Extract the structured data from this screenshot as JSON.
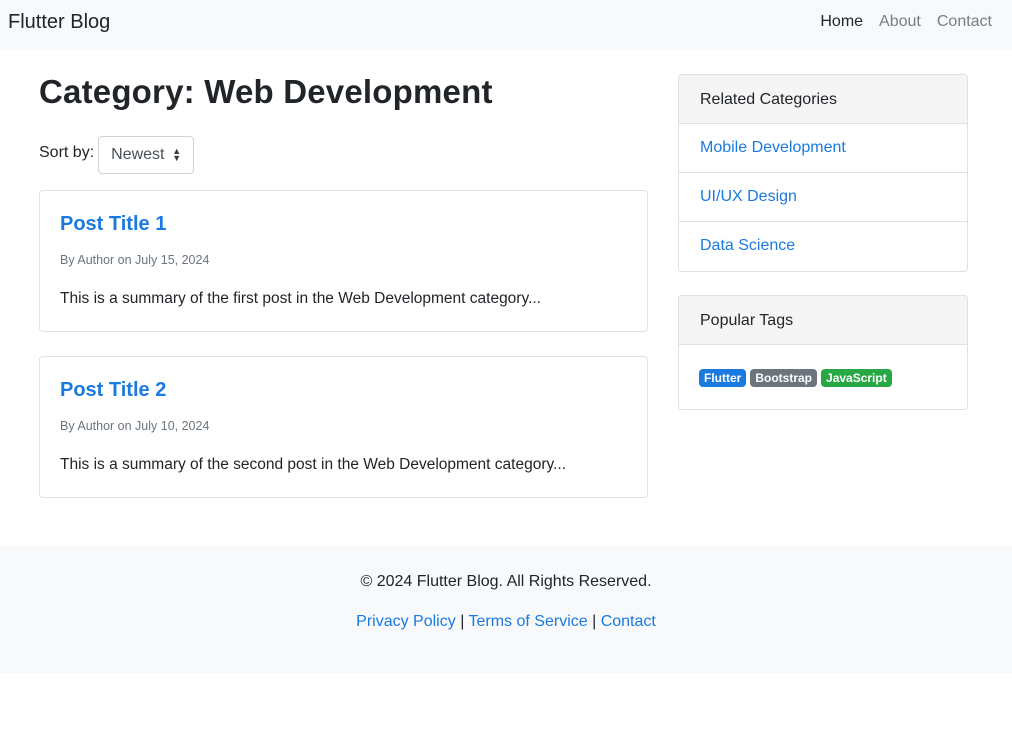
{
  "navbar": {
    "brand": "Flutter Blog",
    "links": [
      {
        "label": "Home",
        "active": true
      },
      {
        "label": "About",
        "active": false
      },
      {
        "label": "Contact",
        "active": false
      }
    ]
  },
  "main": {
    "title": "Category: Web Development",
    "sort": {
      "label": "Sort by:",
      "selected": "Newest"
    },
    "posts": [
      {
        "title": "Post Title 1",
        "meta": "By Author on July 15, 2024",
        "summary": "This is a summary of the first post in the Web Development category..."
      },
      {
        "title": "Post Title 2",
        "meta": "By Author on July 10, 2024",
        "summary": "This is a summary of the second post in the Web Development category..."
      }
    ]
  },
  "sidebar": {
    "related": {
      "header": "Related Categories",
      "items": [
        "Mobile Development",
        "UI/UX Design",
        "Data Science"
      ]
    },
    "tags": {
      "header": "Popular Tags",
      "items": [
        {
          "label": "Flutter",
          "color": "#1a7ae0"
        },
        {
          "label": "Bootstrap",
          "color": "#6c757d"
        },
        {
          "label": "JavaScript",
          "color": "#28a745"
        }
      ]
    }
  },
  "footer": {
    "copyright": "© 2024 Flutter Blog. All Rights Reserved.",
    "links": [
      "Privacy Policy",
      "Terms of Service",
      "Contact"
    ],
    "separator": "|"
  }
}
